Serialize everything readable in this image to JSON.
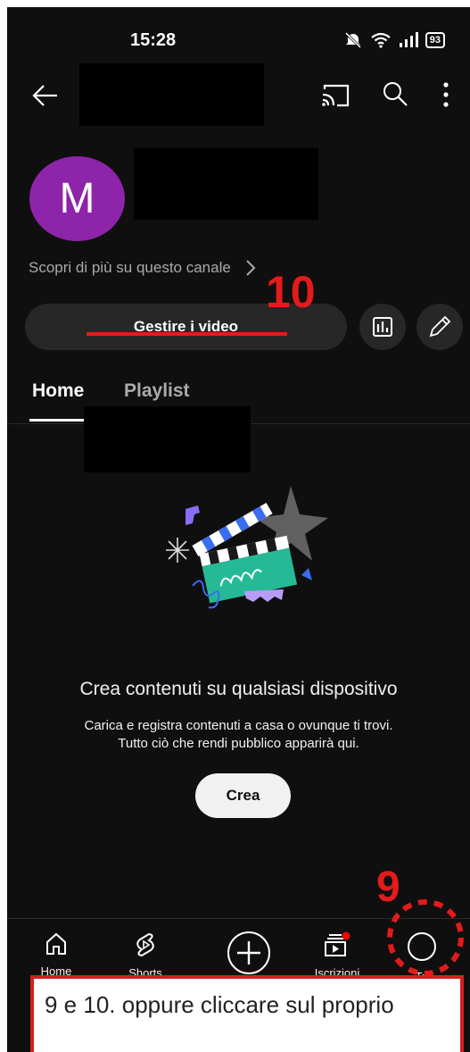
{
  "status_bar": {
    "time": "15:28",
    "battery": "93"
  },
  "header": {
    "back_icon": "arrow-left-icon",
    "cast_icon": "cast-icon",
    "search_icon": "search-icon",
    "more_icon": "more-vertical-icon"
  },
  "channel": {
    "avatar_letter": "M",
    "avatar_color": "#8e24aa",
    "discover_text": "Scopri di più su questo canale",
    "manage_videos_label": "Gestire i video",
    "analytics_icon": "analytics-icon",
    "edit_icon": "pencil-icon"
  },
  "tabs": [
    {
      "label": "Home",
      "selected": true
    },
    {
      "label": "Playlist",
      "selected": false
    }
  ],
  "empty_state": {
    "title": "Crea contenuti su qualsiasi dispositivo",
    "desc_line1": "Carica e registra contenuti a casa o ovunque ti trovi.",
    "desc_line2": "Tutto ciò che rendi pubblico apparirà qui.",
    "create_label": "Crea"
  },
  "bottom_nav": [
    {
      "label": "Home",
      "icon": "home-icon"
    },
    {
      "label": "Shorts",
      "icon": "shorts-icon"
    },
    {
      "label": "",
      "icon": "create-plus-icon"
    },
    {
      "label": "Iscrizioni",
      "icon": "subscriptions-icon"
    },
    {
      "label": "Tu",
      "icon": "profile-circle-icon"
    }
  ],
  "annotations": {
    "step_10": "10",
    "step_9": "9",
    "caption": "9 e 10. oppure cliccare sul proprio",
    "color": "#e31b1b"
  }
}
